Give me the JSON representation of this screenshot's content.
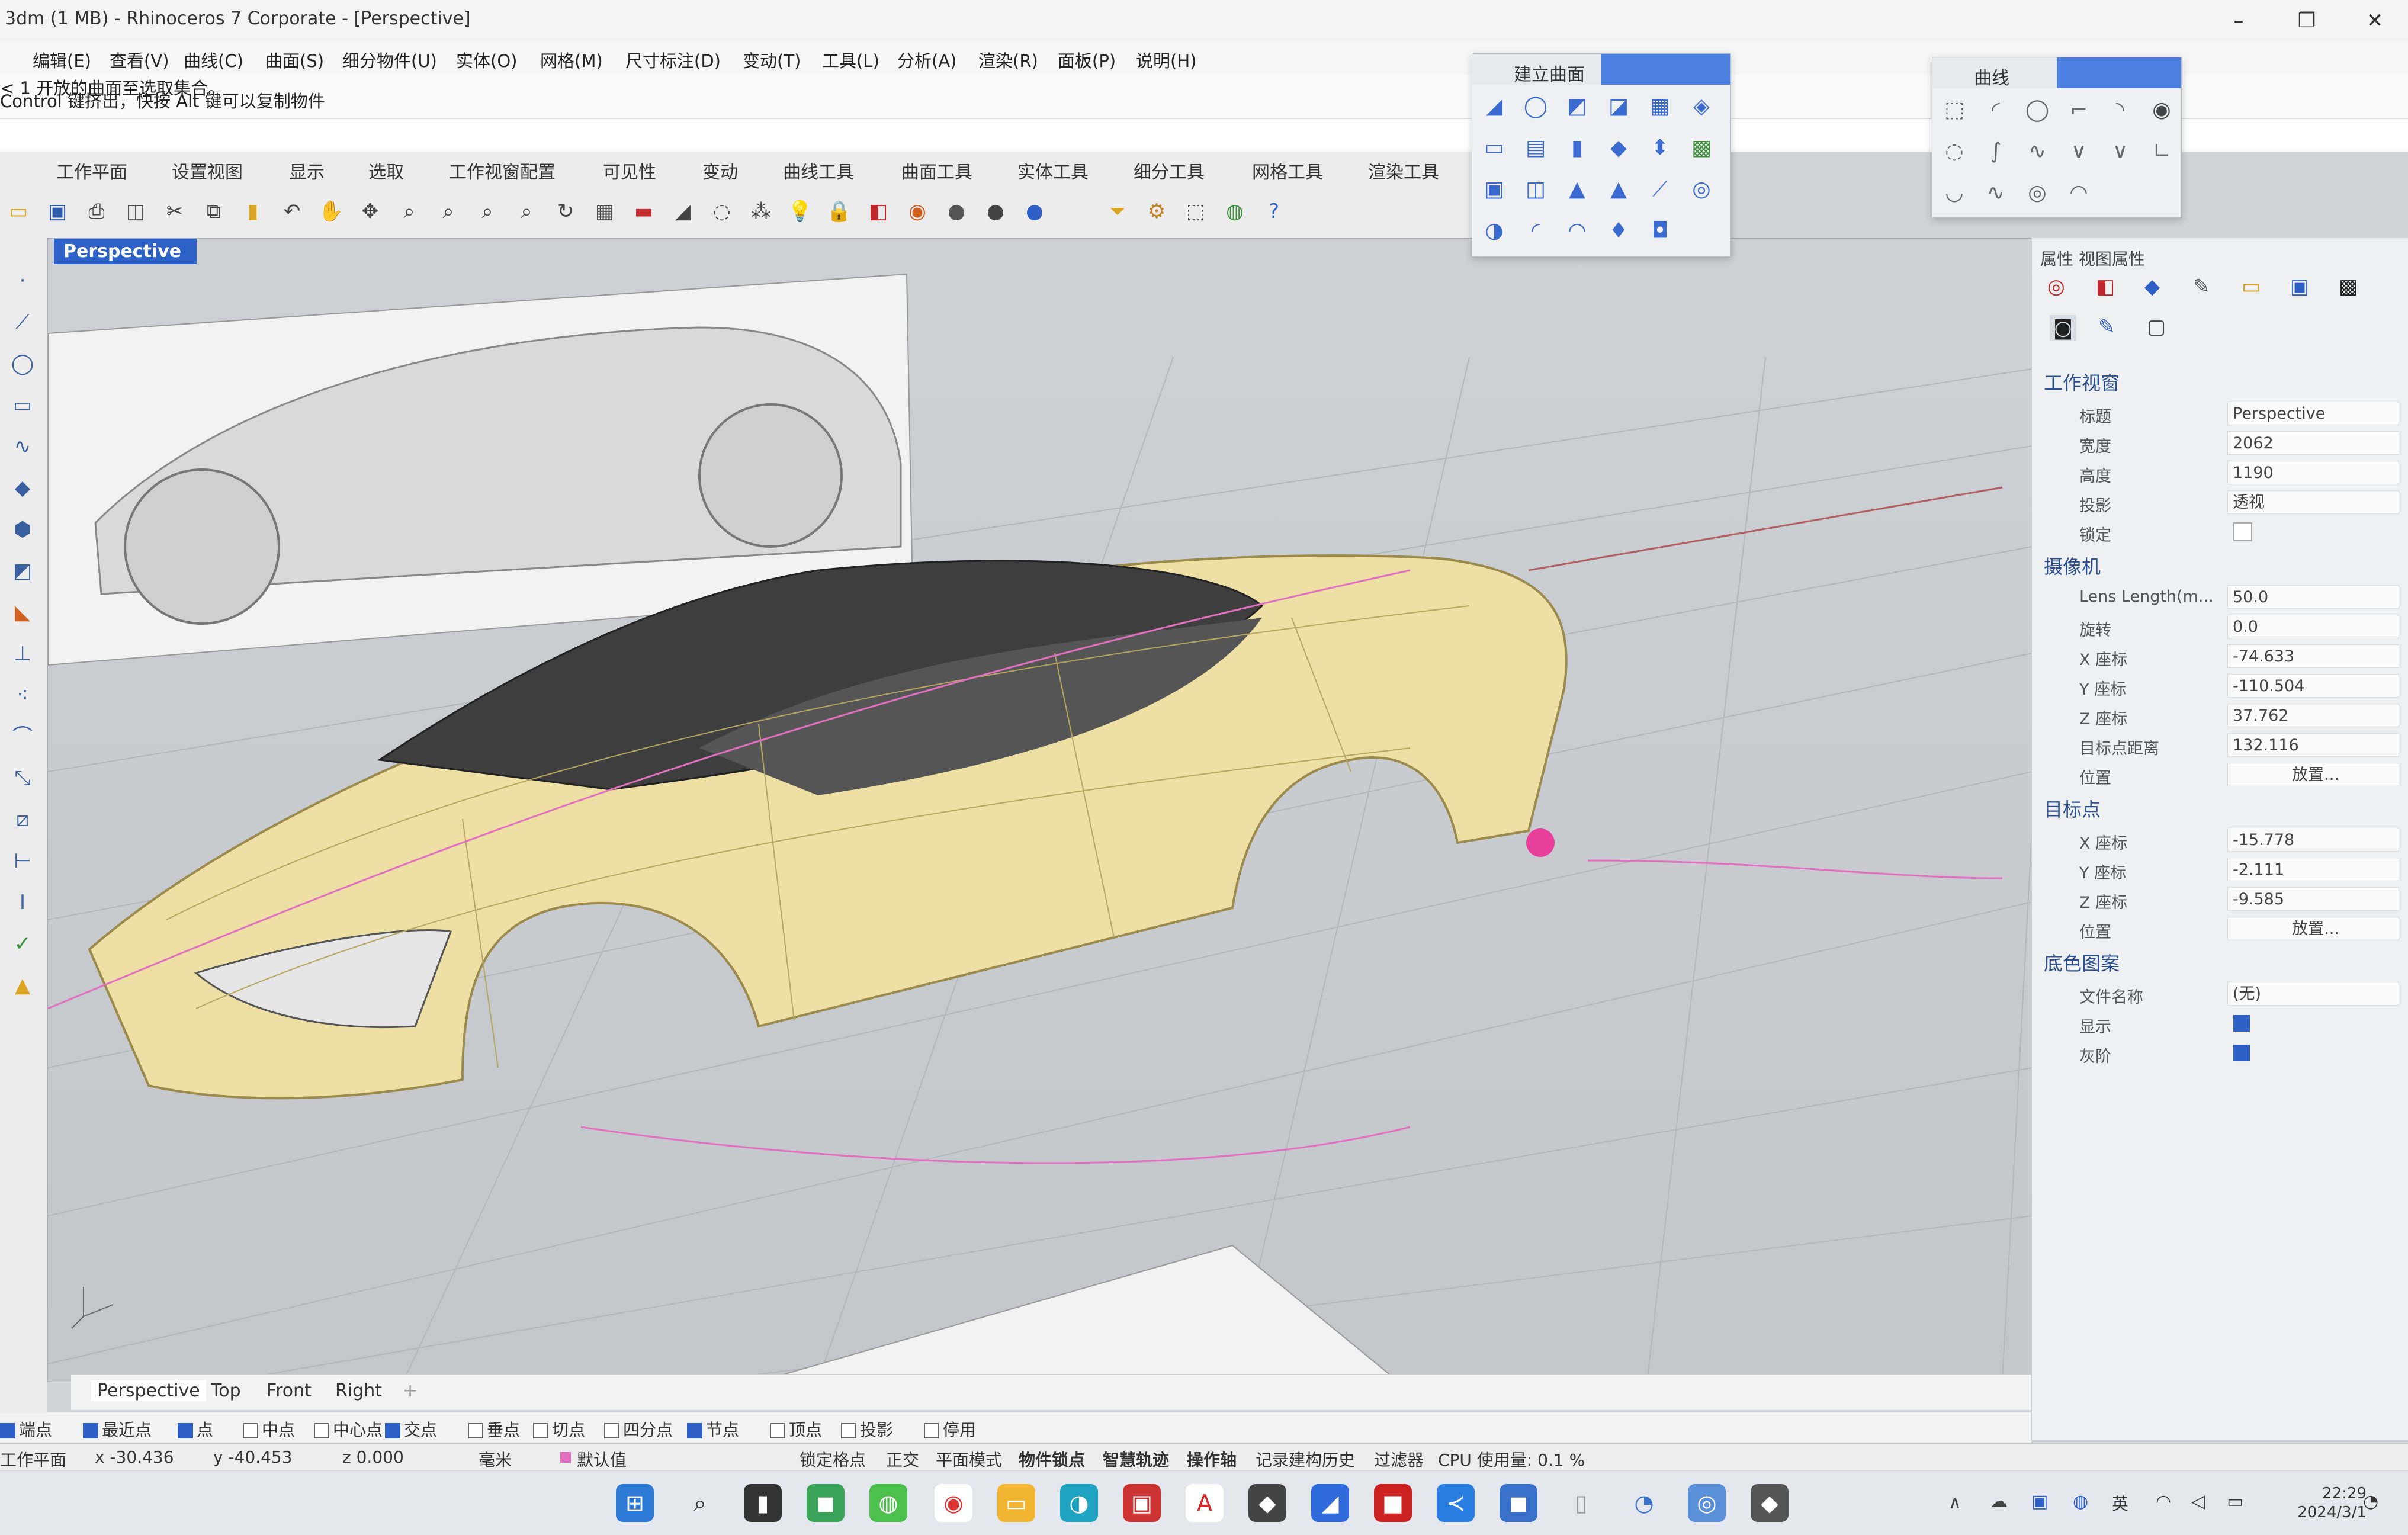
{
  "window": {
    "title": "3dm (1 MB) - Rhinoceros 7 Corporate - [Perspective]",
    "minimize": "–",
    "maximize": "❐",
    "close": "✕"
  },
  "menu": [
    "编辑(E)",
    "查看(V)",
    "曲线(C)",
    "曲面(S)",
    "细分物件(U)",
    "实体(O)",
    "网格(M)",
    "尺寸标注(D)",
    "变动(T)",
    "工具(L)",
    "分析(A)",
    "渲染(R)",
    "面板(P)",
    "说明(H)"
  ],
  "command": {
    "line1": "< 1 开放的曲面至选取集合。",
    "line2": "Control 键挤出，快按 Alt 键可以复制物件"
  },
  "tabs": [
    "工作平面",
    "设置视图",
    "显示",
    "选取",
    "工作视窗配置",
    "可见性",
    "变动",
    "曲线工具",
    "曲面工具",
    "实体工具",
    "细分工具",
    "网格工具",
    "渲染工具"
  ],
  "viewport": {
    "label": "Perspective"
  },
  "viewport_tabs": [
    "Perspective",
    "Top",
    "Front",
    "Right"
  ],
  "osnaps": [
    {
      "label": "端点",
      "checked": true
    },
    {
      "label": "最近点",
      "checked": true
    },
    {
      "label": "点",
      "checked": true
    },
    {
      "label": "中点",
      "checked": false
    },
    {
      "label": "中心点",
      "checked": false
    },
    {
      "label": "交点",
      "checked": true
    },
    {
      "label": "垂点",
      "checked": false
    },
    {
      "label": "切点",
      "checked": false
    },
    {
      "label": "四分点",
      "checked": false
    },
    {
      "label": "节点",
      "checked": true
    },
    {
      "label": "顶点",
      "checked": false
    },
    {
      "label": "投影",
      "checked": false
    },
    {
      "label": "停用",
      "checked": false
    }
  ],
  "status": {
    "cplane": "工作平面",
    "x": "x -30.436",
    "y": "y -40.453",
    "z": "z 0.000",
    "unit": "毫米",
    "layer": "默认值",
    "items": [
      "锁定格点",
      "正交",
      "平面模式",
      "物件锁点",
      "智慧轨迹",
      "操作轴",
      "记录建构历史",
      "过滤器",
      "CPU 使用量: 0.1 %"
    ]
  },
  "panels": {
    "surface": {
      "title": "建立曲面"
    },
    "curve": {
      "title": "曲线"
    }
  },
  "props": {
    "tabs": "属性 视图属性",
    "viewport_section": "工作视窗",
    "title_label": "标题",
    "title_value": "Perspective",
    "width_label": "宽度",
    "width_value": "2062",
    "height_label": "高度",
    "height_value": "1190",
    "proj_label": "投影",
    "proj_value": "透视",
    "lock_label": "锁定",
    "camera_section": "摄像机",
    "lens_label": "Lens Length(m...",
    "lens_value": "50.0",
    "rot_label": "旋转",
    "rot_value": "0.0",
    "cx_label": "X 座标",
    "cx_value": "-74.633",
    "cy_label": "Y 座标",
    "cy_value": "-110.504",
    "cz_label": "Z 座标",
    "cz_value": "37.762",
    "dist_label": "目标点距离",
    "dist_value": "132.116",
    "pos_label": "位置",
    "pos_btn": "放置...",
    "target_section": "目标点",
    "tx_label": "X 座标",
    "tx_value": "-15.778",
    "ty_label": "Y 座标",
    "ty_value": "-2.111",
    "tz_label": "Z 座标",
    "tz_value": "-9.585",
    "tpos_label": "位置",
    "tpos_btn": "放置...",
    "bg_section": "底色图案",
    "file_label": "文件名称",
    "file_value": "(无)",
    "show_label": "显示",
    "gray_label": "灰阶"
  },
  "taskbar": {
    "time": "22:29",
    "date": "2024/3/1",
    "lang": "英"
  }
}
